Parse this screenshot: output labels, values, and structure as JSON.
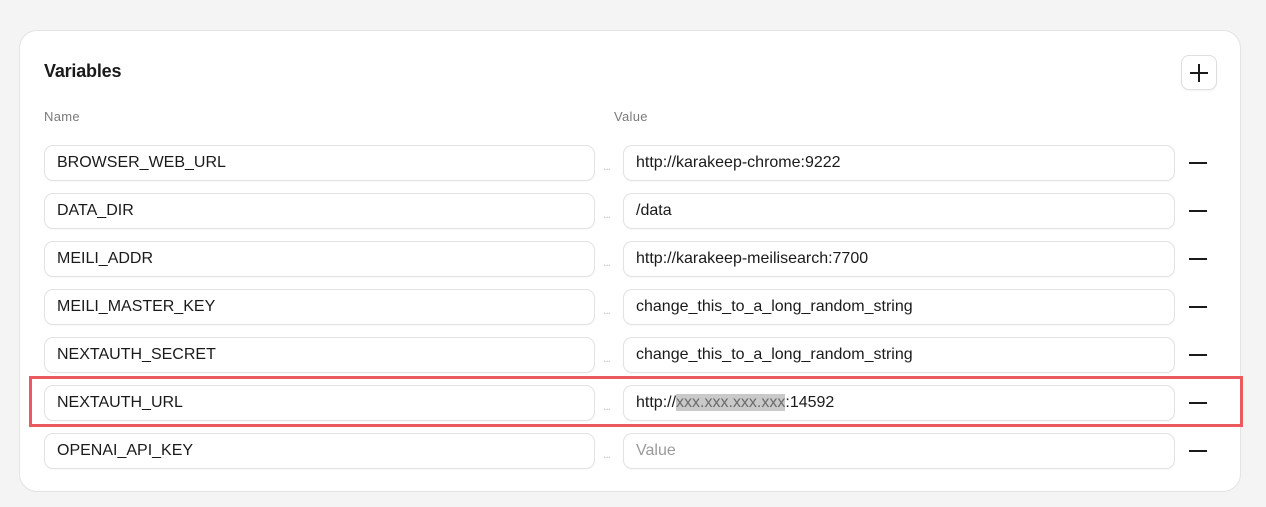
{
  "panel": {
    "title": "Variables",
    "add_icon": "plus-icon",
    "remove_icon": "minus-icon"
  },
  "columns": {
    "name": "Name",
    "value": "Value"
  },
  "separator": "...",
  "highlight_color": "#ea5a5f",
  "rows": [
    {
      "name": "BROWSER_WEB_URL",
      "value": "http://karakeep-chrome:9222"
    },
    {
      "name": "DATA_DIR",
      "value": "/data"
    },
    {
      "name": "MEILI_ADDR",
      "value": "http://karakeep-meilisearch:7700"
    },
    {
      "name": "MEILI_MASTER_KEY",
      "value": "change_this_to_a_long_random_string"
    },
    {
      "name": "NEXTAUTH_SECRET",
      "value": "change_this_to_a_long_random_string"
    },
    {
      "name": "NEXTAUTH_URL",
      "value_prefix": "http://",
      "value_masked": "xxx.xxx.xxx.xxx",
      "value_suffix": ":14592"
    },
    {
      "name": "OPENAI_API_KEY",
      "value": "",
      "placeholder": "Value"
    }
  ]
}
